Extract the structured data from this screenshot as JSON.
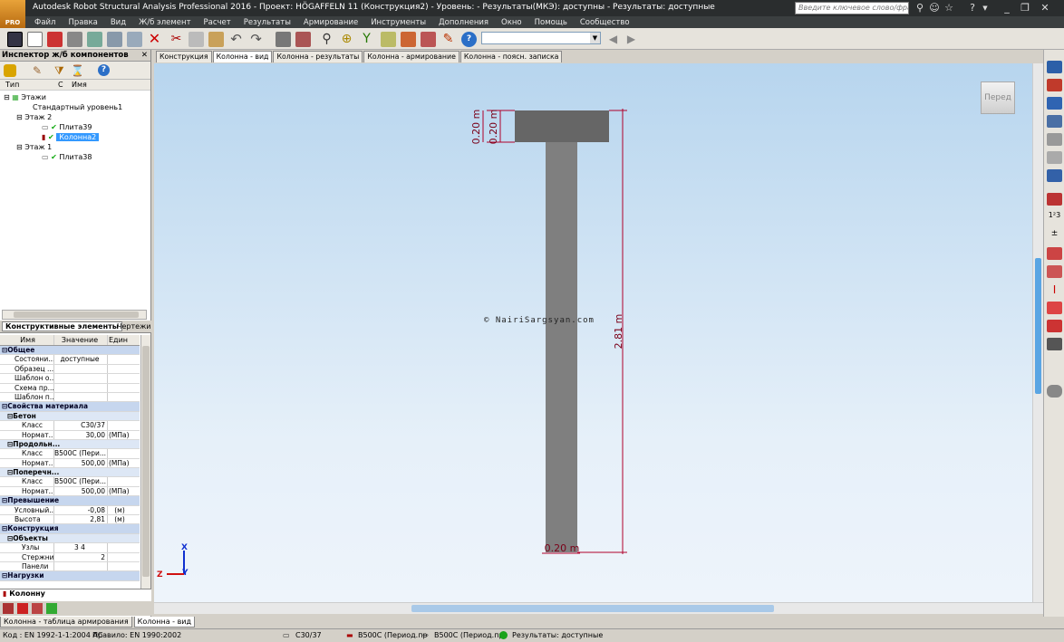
{
  "title": {
    "text": "Autodesk Robot Structural Analysis Professional 2016 - Проект: HÖGAFFELN 11 (Конструкция2) - Уровень:  - Результаты(МКЭ): доступны - Результаты: доступные",
    "logo": "PRO",
    "search_placeholder": "Введите ключевое слово/фразу"
  },
  "menu": [
    "Файл",
    "Правка",
    "Вид",
    "Ж/б элемент",
    "Расчет",
    "Результаты",
    "Армирование",
    "Инструменты",
    "Дополнения",
    "Окно",
    "Помощь",
    "Сообщество"
  ],
  "inspector": {
    "title": "Инспектор ж/б компонентов",
    "columns": {
      "type": "Тип",
      "c": "С",
      "name": "Имя"
    },
    "tree": {
      "root": "Этажи",
      "std_level": "Стандартный уровень1",
      "floor2": "Этаж 2",
      "slab39": "Плита39",
      "column2": "Колонна2",
      "floor1": "Этаж 1",
      "slab38": "Плита38"
    },
    "tabs": {
      "elements": "Конструктивные элементы",
      "drawings": "Чертежи"
    }
  },
  "props": {
    "headers": {
      "name": "Имя",
      "value": "Значение",
      "unit": "Един"
    },
    "general": "Общее",
    "state": {
      "name": "Состояни...",
      "value": "доступные"
    },
    "pattern": {
      "name": "Образец ..."
    },
    "template_o": {
      "name": "Шаблон о..."
    },
    "scheme": {
      "name": "Схема пр..."
    },
    "template_p": {
      "name": "Шаблон п..."
    },
    "material": "Свойства материала",
    "concrete": "Бетон",
    "conc_class": {
      "name": "Класс",
      "value": "C30/37"
    },
    "conc_norm": {
      "name": "Нормат...",
      "value": "30,00",
      "unit": "(МПа)"
    },
    "longit": "Продольн...",
    "long_class": {
      "name": "Класс",
      "value": "B500C (Пери..."
    },
    "long_norm": {
      "name": "Нормат...",
      "value": "500,00",
      "unit": "(МПа)"
    },
    "trans": "Поперечн...",
    "trans_class": {
      "name": "Класс",
      "value": "B500C (Пери..."
    },
    "trans_norm": {
      "name": "Нормат...",
      "value": "500,00",
      "unit": "(МПа)"
    },
    "elevation": "Превышение",
    "cond": {
      "name": "Условный...",
      "value": "-0,08",
      "unit": "(м)"
    },
    "height": {
      "name": "Высота",
      "value": "2,81",
      "unit": "(м)"
    },
    "construction": "Конструкция",
    "objects": "Объекты",
    "nodes": {
      "name": "Узлы",
      "value": "3 4"
    },
    "bars": {
      "name": "Стержни",
      "value": "2"
    },
    "panels": {
      "name": "Панели"
    },
    "loads": "Нагрузки",
    "bottom_tab": "Колонну"
  },
  "doc_tabs": [
    "Конструкция",
    "Колонна - вид",
    "Колонна - результаты",
    "Колонна - армирование",
    "Колонна - поясн. записка"
  ],
  "drawing": {
    "dim_top_outer": "0.20 m",
    "dim_top_inner": "0.20 m",
    "dim_height": "2.81 m",
    "dim_bottom": "0.20 m",
    "watermark": "© NairiSargsyan.com",
    "view_cube": "Перед",
    "axis_x": "X",
    "axis_y": "Y",
    "axis_z": "Z"
  },
  "bottom_tabs": [
    "Колонна - таблица армирования",
    "Колонна - вид"
  ],
  "status": {
    "code": "Код : EN 1992-1-1:2004 AC",
    "rule": "Правило: EN 1990:2002",
    "concrete": "C30/37",
    "rebar1": "B500C (Период.пр",
    "rebar2": "B500C (Период.пр",
    "results": "Результаты: доступные"
  },
  "colors": {
    "selection": "#3399ff",
    "dim_line": "#b0002a",
    "column": "#7f7f7f",
    "slab": "#666666",
    "status_ok": "#1aa31a"
  }
}
